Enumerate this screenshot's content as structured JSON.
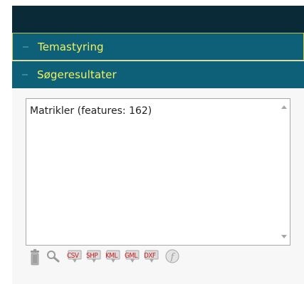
{
  "sections": [
    {
      "label": "Temastyring"
    },
    {
      "label": "Søgeresultater"
    }
  ],
  "results": {
    "items": [
      "Matrikler (features: 162)"
    ]
  },
  "toolbar": {
    "icons": [
      "trash-icon",
      "search-icon",
      "download-csv-icon",
      "download-shp-icon",
      "download-kml-icon",
      "download-gml-icon",
      "download-dxf-icon",
      "info-icon"
    ],
    "csv_label": "CSV",
    "shp_label": "SHP",
    "kml_label": "KML",
    "gml_label": "GML",
    "dxf_label": "DXF"
  },
  "colors": {
    "header_dark": "#092a36",
    "section_bg": "#0e5f78",
    "section_text": "#f2f260",
    "download_text": "#cc2222"
  }
}
